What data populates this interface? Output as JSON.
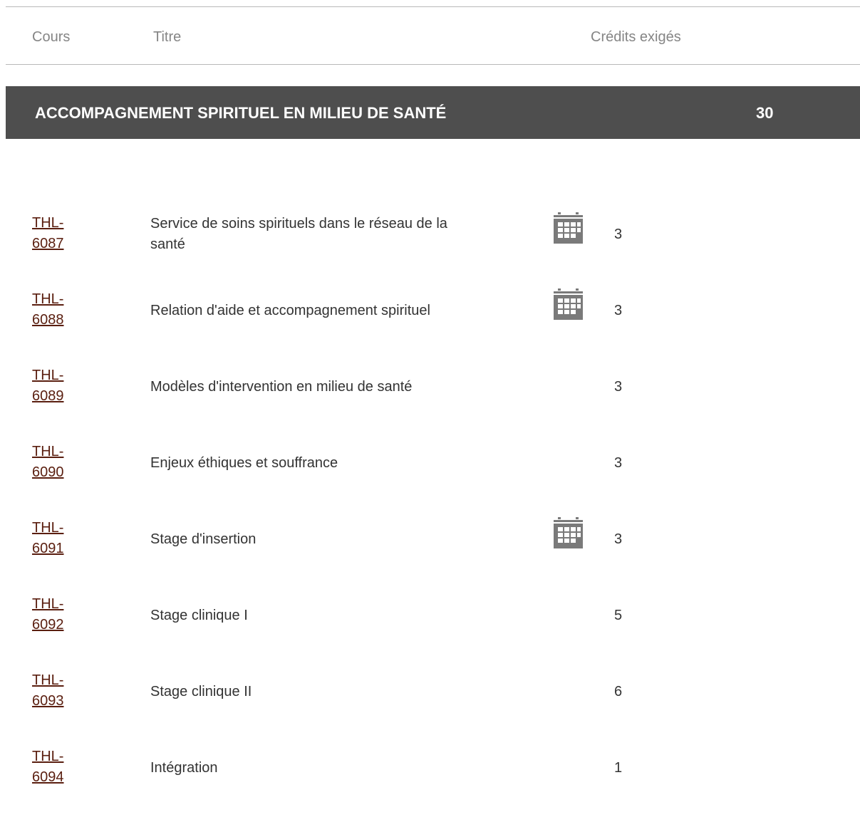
{
  "header": {
    "cours_label": "Cours",
    "titre_label": "Titre",
    "credits_label": "Crédits exigés"
  },
  "program": {
    "title": "ACCOMPAGNEMENT SPIRITUEL EN MILIEU DE SANTÉ",
    "credits": "30"
  },
  "courses": [
    {
      "code": "THL-\n6087",
      "title": "Service de soins spirituels dans le réseau de la santé",
      "credits": "3",
      "has_schedule": true
    },
    {
      "code": "THL-\n6088",
      "title": "Relation d'aide et accompagnement spirituel",
      "credits": "3",
      "has_schedule": true
    },
    {
      "code": "THL-\n6089",
      "title": "Modèles d'intervention en milieu de santé",
      "credits": "3",
      "has_schedule": false
    },
    {
      "code": "THL-\n6090",
      "title": "Enjeux éthiques et souffrance",
      "credits": "3",
      "has_schedule": false
    },
    {
      "code": "THL-\n6091",
      "title": "Stage d'insertion",
      "credits": "3",
      "has_schedule": true
    },
    {
      "code": "THL-\n6092",
      "title": "Stage clinique I",
      "credits": "5",
      "has_schedule": false
    },
    {
      "code": "THL-\n6093",
      "title": "Stage clinique II",
      "credits": "6",
      "has_schedule": false
    },
    {
      "code": "THL-\n6094",
      "title": "Intégration",
      "credits": "1",
      "has_schedule": false
    }
  ],
  "icons": {
    "schedule": "calendar-icon"
  },
  "colors": {
    "program_bar": "#4e4e4e",
    "link": "#5a1e0f",
    "header_text": "#858585",
    "icon": "#7a7a7a"
  }
}
